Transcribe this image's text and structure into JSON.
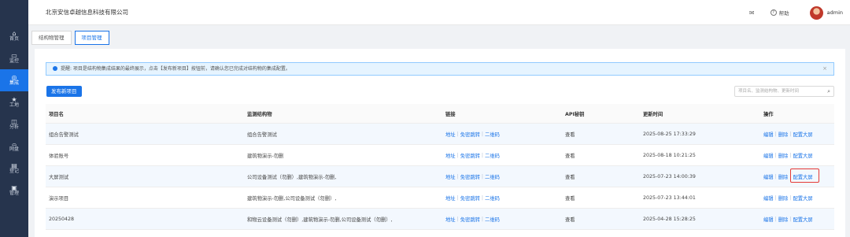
{
  "header": {
    "company": "北京安信卓越信息科技有限公司",
    "help": "帮助",
    "user": "admin"
  },
  "sidebar": {
    "items": [
      {
        "icon": "⌂",
        "label": "首页"
      },
      {
        "icon": "▭",
        "label": "监控"
      },
      {
        "icon": "◎",
        "label": "集成"
      },
      {
        "icon": "★",
        "label": "工地"
      },
      {
        "icon": "◫",
        "label": "分析"
      },
      {
        "icon": "⌓",
        "label": "网盘"
      },
      {
        "icon": "▤",
        "label": "登记"
      },
      {
        "icon": "▣",
        "label": "管理"
      }
    ],
    "active": 2
  },
  "tabs": [
    {
      "label": "结构物管理"
    },
    {
      "label": "项目管理"
    }
  ],
  "alert": {
    "text": "提醒: 项目是结构物集成结果的最终展示，点击【发布新项目】按钮前，请确认您已完成对结构物的集成配置。"
  },
  "toolbar": {
    "publish_label": "发布新项目",
    "search_placeholder": "项目名、监测结构物、更新时间"
  },
  "table": {
    "headers": [
      "项目名",
      "监测结构物",
      "链接",
      "API秘钥",
      "更新时间",
      "操作"
    ],
    "rows": [
      {
        "name": "组合告警测试",
        "structure": "组合告警测试",
        "links": [
          "地址",
          "免密跳转",
          "二维码"
        ],
        "api": "查看",
        "time": "2025-08-25 17:33:29",
        "actions": [
          "编辑",
          "删除",
          "配置大屏"
        ]
      },
      {
        "name": "体验账号",
        "structure": "建筑物演示-勿删",
        "links": [
          "地址",
          "免密跳转",
          "二维码"
        ],
        "api": "查看",
        "time": "2025-08-18 10:21:25",
        "actions": [
          "编辑",
          "删除",
          "配置大屏"
        ]
      },
      {
        "name": "大屏测试",
        "structure": "公司设备测试（勿删）,建筑物演示-勿删,",
        "links": [
          "地址",
          "免密跳转",
          "二维码"
        ],
        "api": "查看",
        "time": "2025-07-23 14:00:39",
        "actions": [
          "编辑",
          "删除",
          "配置大屏"
        ]
      },
      {
        "name": "演示项目",
        "structure": "建筑物演示-勿删,公司设备测试（勿删）,",
        "links": [
          "地址",
          "免密跳转",
          "二维码"
        ],
        "api": "查看",
        "time": "2025-07-23 13:44:01",
        "actions": [
          "编辑",
          "删除",
          "配置大屏"
        ]
      },
      {
        "name": "20250428",
        "structure": "和物云设备测试（勿删）,建筑物演示-勿删,公司设备测试（勿删）,",
        "links": [
          "地址",
          "免密跳转",
          "二维码"
        ],
        "api": "查看",
        "time": "2025-04-28 15:28:25",
        "actions": [
          "编辑",
          "删除",
          "配置大屏"
        ]
      }
    ]
  }
}
